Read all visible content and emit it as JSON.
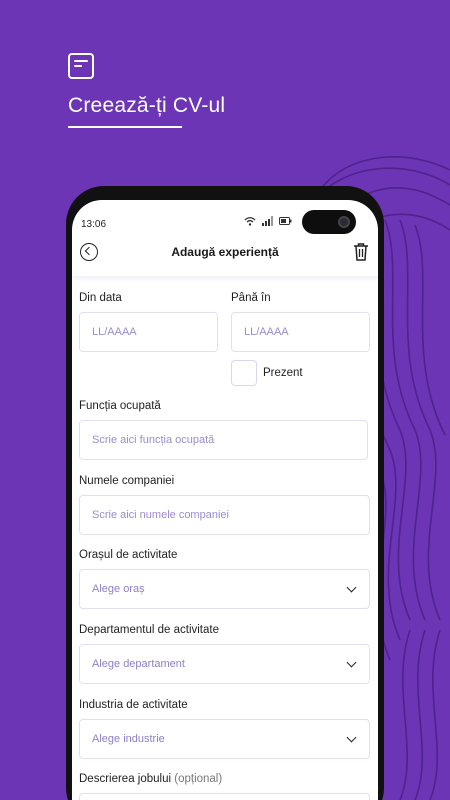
{
  "promo": {
    "icon": "document-icon",
    "headline": "Creează-ți CV-ul"
  },
  "status_bar": {
    "time": "13:06",
    "icons": [
      "wifi-icon",
      "signal-icon",
      "battery-icon"
    ]
  },
  "appbar": {
    "title": "Adaugă experiență",
    "back_icon": "back-circle-icon",
    "delete_icon": "trash-icon"
  },
  "form": {
    "from_date": {
      "label": "Din data",
      "placeholder": "LL/AAAA"
    },
    "to_date": {
      "label": "Până în",
      "placeholder": "LL/AAAA"
    },
    "present": {
      "label": "Prezent",
      "checked": false
    },
    "position": {
      "label": "Funcția ocupată",
      "placeholder": "Scrie aici funcția ocupată"
    },
    "company": {
      "label": "Numele companiei",
      "placeholder": "Scrie aici numele companiei"
    },
    "city": {
      "label": "Orașul de activitate",
      "value": "Alege oraș"
    },
    "department": {
      "label": "Departamentul de activitate",
      "value": "Alege departament"
    },
    "industry": {
      "label": "Industria de activitate",
      "value": "Alege industrie"
    },
    "description": {
      "label": "Descrierea jobului",
      "optional": "(opțional)"
    }
  },
  "colors": {
    "background": "#6c35b5",
    "placeholder": "#9a8ccc",
    "field_border": "#e3def0"
  }
}
